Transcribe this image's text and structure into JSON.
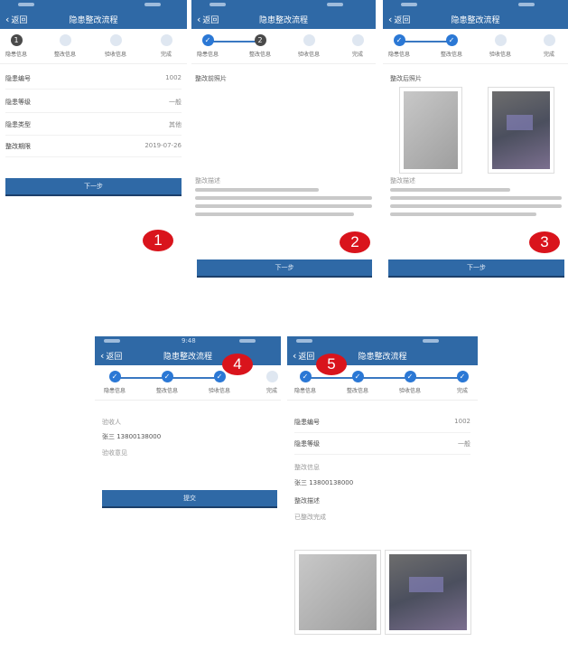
{
  "nav": {
    "back": "< 返回",
    "back_text": "返回",
    "title": "隐患整改流程"
  },
  "steps": [
    "隐患信息",
    "整改信息",
    "验收信息",
    "完成"
  ],
  "panel1": {
    "rows": [
      {
        "label": "隐患编号",
        "value": "1002"
      },
      {
        "label": "隐患等级",
        "value": "一般"
      },
      {
        "label": "隐患类型",
        "value": "其他"
      },
      {
        "label": "整改期限",
        "value": "2019-07-26"
      }
    ],
    "button": "下一步"
  },
  "panel2": {
    "section": "整改前照片",
    "desc_title": "整改描述",
    "button": "下一步"
  },
  "panel3": {
    "section": "整改后照片",
    "desc_title": "整改描述",
    "button": "下一步"
  },
  "panel4": {
    "status": "9:48",
    "label1": "验收人",
    "value1": "张三 13800138000",
    "label2": "验收意见",
    "button": "提交"
  },
  "panel5": {
    "rows": [
      {
        "label": "隐患编号",
        "value": "1002"
      },
      {
        "label": "隐患等级",
        "value": "一般"
      }
    ],
    "section": "整改信息",
    "l1": "张三 13800138000",
    "l2": "整改描述",
    "l3": "已整改完成"
  },
  "badges": [
    "1",
    "2",
    "3",
    "4",
    "5"
  ],
  "colors": {
    "accent": "#2f69a6",
    "badge": "#d9141c",
    "step_done": "#2b78d5"
  }
}
